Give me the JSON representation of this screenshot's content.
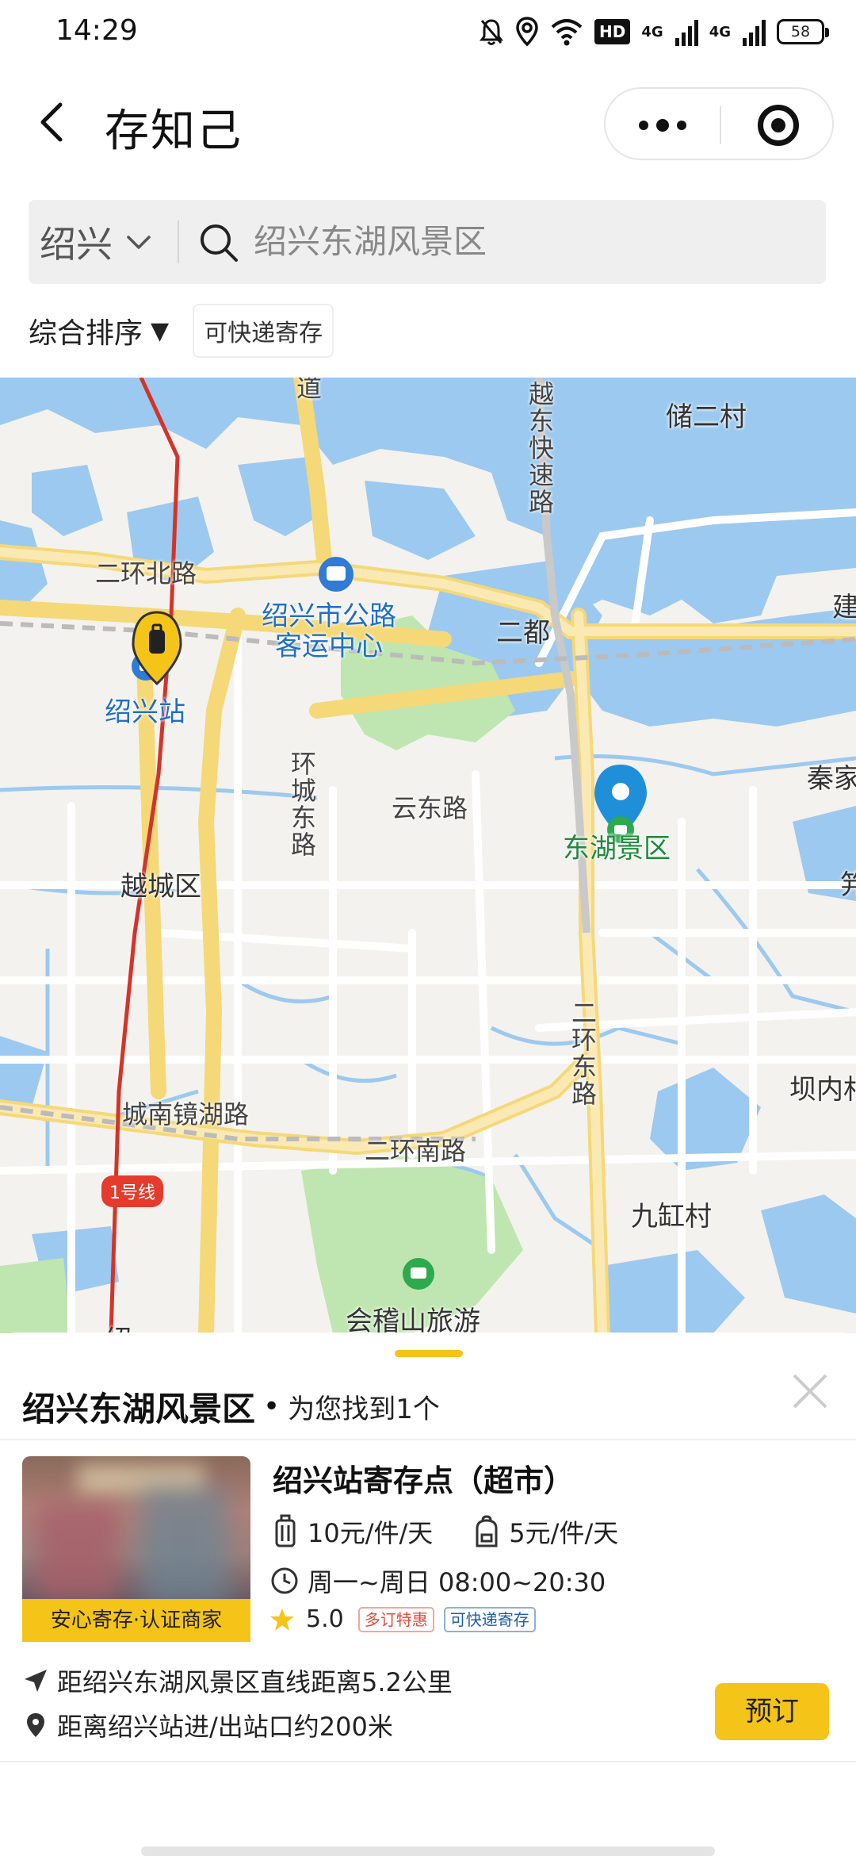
{
  "status_bar": {
    "time": "14:29",
    "hd_label": "HD",
    "net1": "4G",
    "net2": "4G",
    "battery": "58"
  },
  "navbar": {
    "title": "存知己"
  },
  "search": {
    "city": "绍兴",
    "query": "绍兴东湖风景区"
  },
  "filters": {
    "sort_label": "综合排序",
    "sort_arrow": "▼",
    "chip": "可快递寄存"
  },
  "map": {
    "labels": {
      "road_dao": "道",
      "yuedong_expressway": "越东快速路",
      "chu_er_cun": "储二村",
      "er_huan_bei_lu": "二环北路",
      "bus_center": "绍兴市公路客运中心",
      "er_du": "二都",
      "jian": "建",
      "shaoxing_station": "绍兴站",
      "huan_cheng_dong_lu": "环城东路",
      "yun_dong_lu": "云东路",
      "qin_jia": "秦家",
      "donghu": "东湖景区",
      "yuecheng": "越城区",
      "zhi": "笄",
      "er_huan_dong_lu": "二环东路",
      "ba_nei": "坝内村",
      "chengnan": "城南镜湖路",
      "er_huan_nan_lu": "二环南路",
      "metro_line": "1号线",
      "jiu_gang_cun": "九缸村",
      "kuaiji": "会稽山旅游",
      "shao": "绍"
    },
    "colors": {
      "water": "#9cc9ef",
      "land": "#f4f2ee",
      "road": "#ffffff",
      "major_road": "#fbe39a",
      "metro": "#d3342a",
      "park": "#bfe6b0"
    }
  },
  "result": {
    "title": "绍兴东湖风景区",
    "dot": "•",
    "count_text": "为您找到1个",
    "store": {
      "badge": "安心寄存·认证商家",
      "name": "绍兴站寄存点（超市）",
      "price_large": "10元/件/天",
      "price_small": "5元/件/天",
      "hours": "周一~周日 08:00~20:30",
      "rating": "5.0",
      "tag1": "多订特惠",
      "tag2": "可快递寄存",
      "distance_scenic": "距绍兴东湖风景区直线距离5.2公里",
      "distance_station": "距离绍兴站进/出站口约200米",
      "book_label": "预订"
    }
  },
  "theme": {
    "accent": "#f5c418",
    "pin_blue": "#1e8fd8"
  }
}
